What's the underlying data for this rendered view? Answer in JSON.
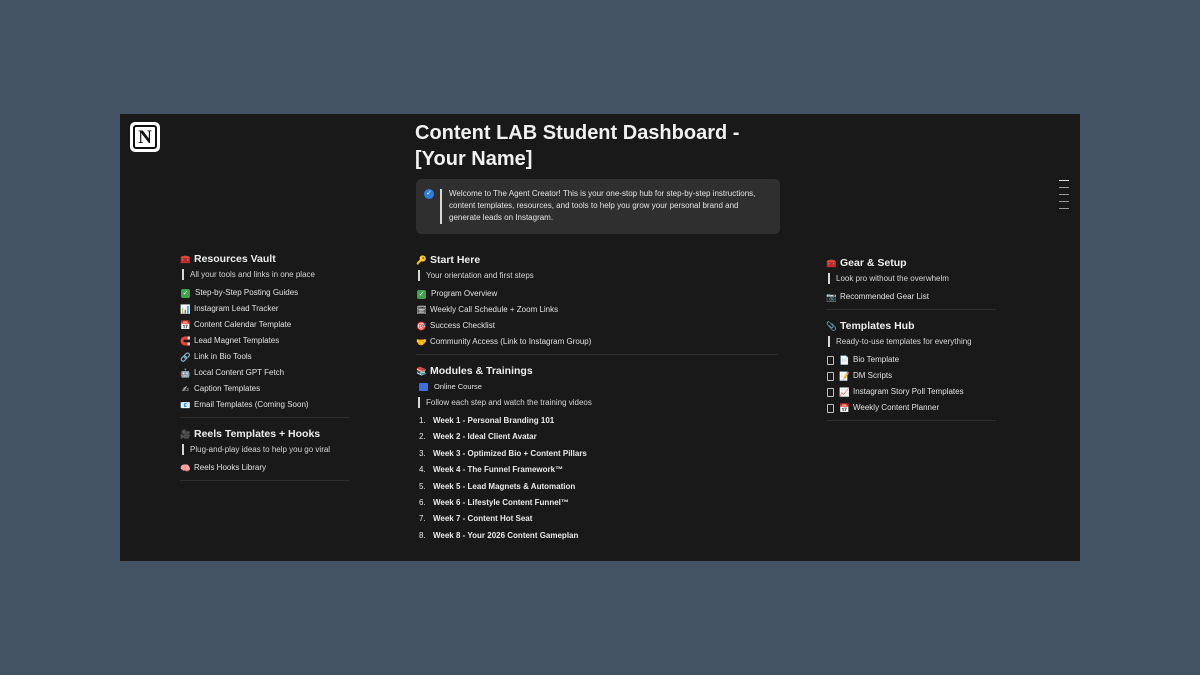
{
  "page": {
    "title": "Content LAB Student Dashboard - [Your Name]"
  },
  "callout": {
    "icon": "check-badge-icon",
    "text": "Welcome to The Agent Creator! This is your one-stop hub for step-by-step instructions, content templates, resources, and tools to help you grow your personal brand and generate leads on Instagram."
  },
  "resources": {
    "title": "Resources Vault",
    "icon": "🧰",
    "subtitle": "All your tools and links in one place",
    "items": [
      {
        "icon": "✓",
        "label": "Step-by-Step Posting Guides"
      },
      {
        "icon": "📊",
        "label": "Instagram Lead Tracker"
      },
      {
        "icon": "📅",
        "label": "Content Calendar Template"
      },
      {
        "icon": "🧲",
        "label": "Lead Magnet Templates"
      },
      {
        "icon": "🔗",
        "label": "Link in Bio Tools"
      },
      {
        "icon": "🤖",
        "label": "Local Content GPT Fetch"
      },
      {
        "icon": "✍",
        "label": "Caption Templates"
      },
      {
        "icon": "📧",
        "label": "Email Templates (Coming Soon)"
      }
    ]
  },
  "reels": {
    "title": "Reels Templates + Hooks",
    "icon": "🎥",
    "subtitle": "Plug-and-play ideas to help you go viral",
    "items": [
      {
        "icon": "🧠",
        "label": "Reels Hooks Library"
      }
    ]
  },
  "start": {
    "title": "Start Here",
    "icon": "🔑",
    "subtitle": "Your orientation and first steps",
    "items": [
      {
        "icon": "✓",
        "label": "Program Overview"
      },
      {
        "icon": "🗓",
        "label": "Weekly Call Schedule + Zoom Links"
      },
      {
        "icon": "🎯",
        "label": "Success Checklist"
      },
      {
        "icon": "🤝",
        "label": "Community Access (Link to Instagram Group)"
      }
    ]
  },
  "modules": {
    "title": "Modules & Trainings",
    "icon": "📚",
    "course_label": "Online Course",
    "subtitle": "Follow each step and watch the training videos",
    "weeks": [
      {
        "num": "1.",
        "label": "Week 1 - Personal Branding 101"
      },
      {
        "num": "2.",
        "label": "Week 2 - Ideal Client Avatar"
      },
      {
        "num": "3.",
        "label": "Week 3 - Optimized Bio + Content Pillars"
      },
      {
        "num": "4.",
        "label": "Week 4 - The Funnel Framework™"
      },
      {
        "num": "5.",
        "label": "Week 5 - Lead Magnets & Automation"
      },
      {
        "num": "6.",
        "label": "Week 6 - Lifestyle Content Funnel™"
      },
      {
        "num": "7.",
        "label": "Week 7 - Content Hot Seat"
      },
      {
        "num": "8.",
        "label": "Week 8 - Your 2026 Content Gameplan"
      }
    ]
  },
  "gear": {
    "title": "Gear & Setup",
    "icon": "🧰",
    "subtitle": "Look pro without the overwhelm",
    "items": [
      {
        "icon": "📷",
        "label": "Recommended Gear List"
      }
    ]
  },
  "templates": {
    "title": "Templates Hub",
    "icon": "📎",
    "subtitle": "Ready-to-use templates for everything",
    "items": [
      {
        "icon": "📄",
        "label": "Bio Template"
      },
      {
        "icon": "📝",
        "label": "DM Scripts"
      },
      {
        "icon": "📈",
        "label": "Instagram Story Poll Templates"
      },
      {
        "icon": "📅",
        "label": "Weekly Content Planner"
      }
    ]
  },
  "colors": {
    "background": "#435364",
    "window": "#191919",
    "callout": "#2f2f2f",
    "text": "#e2e2e2"
  }
}
